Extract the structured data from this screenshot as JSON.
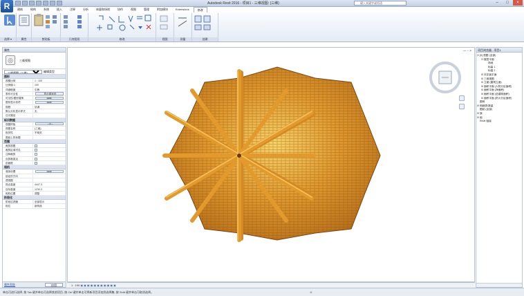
{
  "app": {
    "title": "Autodesk Revit 2016 - 项目1 - 三维视图: {三维}",
    "menu_logo": "R",
    "search_placeholder": "键入关键字或短语"
  },
  "ribbon": {
    "tabs": [
      "建筑",
      "结构",
      "系统",
      "插入",
      "注释",
      "分析",
      "体量和场地",
      "协作",
      "视图",
      "管理",
      "附加模块",
      "Extensions",
      "修改"
    ],
    "active_tab_index": 12,
    "groups": [
      {
        "label": "选择 ▾"
      },
      {
        "label": "属性"
      },
      {
        "label": "剪贴板"
      },
      {
        "label": "几何图形"
      },
      {
        "label": "修改"
      },
      {
        "label": "视图"
      },
      {
        "label": "测量"
      },
      {
        "label": "创建"
      }
    ]
  },
  "properties": {
    "title": "属性",
    "type_name": "三维视图",
    "view_selector": "三维视图: {三维}",
    "edit_type": "编辑类型",
    "sections": [
      {
        "name": "图形",
        "rows": [
          {
            "k": "视图比例",
            "v": "1 : 100"
          },
          {
            "k": "比例值 1:",
            "v": "100"
          },
          {
            "k": "详细程度",
            "v": "中等"
          },
          {
            "k": "零件可见性",
            "v": "显示原状态",
            "btn": true
          },
          {
            "k": "可见性/图形替换",
            "v": "编辑...",
            "btn": true
          },
          {
            "k": "图形显示选项",
            "v": "编辑...",
            "btn": true
          },
          {
            "k": "规程",
            "v": "协调"
          },
          {
            "k": "默认分析显示样式",
            "v": "无"
          },
          {
            "k": "日光路径",
            "v": ""
          }
        ]
      },
      {
        "name": "标识数据",
        "rows": [
          {
            "k": "视图样板",
            "v": "<无>",
            "btn": true
          },
          {
            "k": "视图名称",
            "v": "{三维}"
          },
          {
            "k": "相关性",
            "v": "不相关"
          },
          {
            "k": "图纸上的标题",
            "v": ""
          }
        ]
      },
      {
        "name": "范围",
        "rows": [
          {
            "k": "裁剪视图",
            "v": "",
            "chk": true
          },
          {
            "k": "裁剪区域可见",
            "v": "",
            "chk": true
          },
          {
            "k": "注释裁剪",
            "v": "",
            "chk": true
          },
          {
            "k": "远剪裁激活",
            "v": "",
            "chk": true
          },
          {
            "k": "剖面框",
            "v": "",
            "chk": true
          }
        ]
      },
      {
        "name": "相机",
        "rows": [
          {
            "k": "渲染设置",
            "v": "编辑...",
            "btn": true
          },
          {
            "k": "锁定的方向",
            "v": ""
          },
          {
            "k": "透视图",
            "v": ""
          },
          {
            "k": "视点高度",
            "v": "4447.3"
          },
          {
            "k": "目标高度",
            "v": "1230.3"
          },
          {
            "k": "相机位置",
            "v": "调整"
          }
        ]
      },
      {
        "name": "阶段化",
        "rows": [
          {
            "k": "阶段过滤器",
            "v": "全部显示"
          },
          {
            "k": "相位",
            "v": "新构造"
          }
        ]
      }
    ],
    "help_link": "属性帮助",
    "apply": "应用"
  },
  "canvas": {
    "scale": "1 : 100",
    "controls": "— ▫ ×"
  },
  "project_browser": {
    "title": "项目浏览器 - 项目1",
    "items": [
      {
        "level": 0,
        "toggle": "⊟",
        "label": "[0] 视图 (全部)"
      },
      {
        "level": 1,
        "toggle": "⊟",
        "label": "楼层平面"
      },
      {
        "level": 2,
        "toggle": "",
        "label": "场地"
      },
      {
        "level": 2,
        "toggle": "",
        "label": "标高 1"
      },
      {
        "level": 2,
        "toggle": "",
        "label": "标高 2"
      },
      {
        "level": 1,
        "toggle": "⊞",
        "label": "天花板平面"
      },
      {
        "level": 1,
        "toggle": "⊞",
        "label": "三维视图"
      },
      {
        "level": 1,
        "toggle": "⊞",
        "label": "立面 (建筑立面)"
      },
      {
        "level": 1,
        "toggle": "⊞",
        "label": "面积平面 (人防分区面积)"
      },
      {
        "level": 1,
        "toggle": "⊞",
        "label": "面积平面 (净面积)"
      },
      {
        "level": 1,
        "toggle": "⊞",
        "label": "面积平面 (总建筑面积)"
      },
      {
        "level": 1,
        "toggle": "⊞",
        "label": "面积平面 (防火分区面积)"
      },
      {
        "level": 0,
        "toggle": "",
        "label": "图例"
      },
      {
        "level": 0,
        "toggle": "⊞",
        "label": "明细表/数量"
      },
      {
        "level": 0,
        "toggle": "",
        "label": "图纸 (全部)"
      },
      {
        "level": 0,
        "toggle": "⊞",
        "label": "族"
      },
      {
        "level": 0,
        "toggle": "⊞",
        "label": "组"
      },
      {
        "level": 0,
        "toggle": "",
        "label": "Revit 链接"
      }
    ]
  },
  "status": {
    "text": "单击可进行选择; 按 Tab 键并单击可选择其他项目; 按 Ctrl 键并单击可将新项目添加到选择集; 按 Shift 键并单击可取消选择。",
    "model": ":0"
  }
}
